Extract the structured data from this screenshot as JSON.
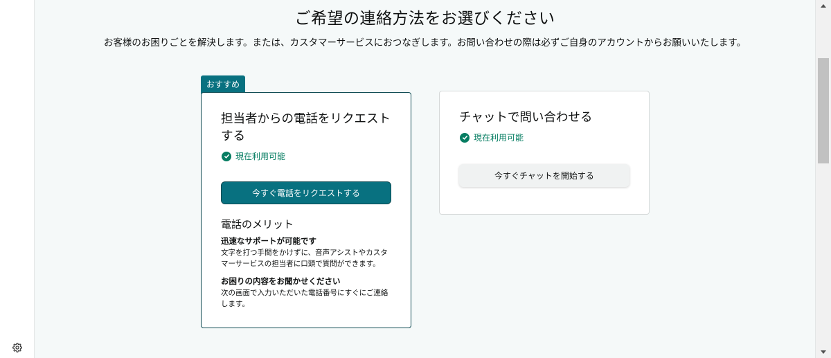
{
  "page": {
    "title": "ご希望の連絡方法をお選びください",
    "description": "お客様のお困りごとを解決します。または、カスタマーサービスにおつなぎします。お問い合わせの際は必ずご自身のアカウントからお願いいたします。"
  },
  "recommended_badge": "おすすめ",
  "phone_card": {
    "title": "担当者からの電話をリクエストする",
    "availability": "現在利用可能",
    "button_label": "今すぐ電話をリクエストする",
    "benefits_title": "電話のメリット",
    "benefits": [
      {
        "heading": "迅速なサポートが可能です",
        "text": "文字を打つ手間をかけずに、音声アシストやカスタマーサービスの担当者に口頭で質問ができます。"
      },
      {
        "heading": "お困りの内容をお聞かせください",
        "text": "次の画面で入力いただいた電話番号にすぐにご連絡します。"
      }
    ]
  },
  "chat_card": {
    "title": "チャットで問い合わせる",
    "availability": "現在利用可能",
    "button_label": "今すぐチャットを開始する"
  },
  "icons": {
    "settings": "gear-icon",
    "available": "check-circle-icon"
  },
  "colors": {
    "accent": "#087180",
    "available_green": "#067d62",
    "background": "#f5f9f9"
  }
}
